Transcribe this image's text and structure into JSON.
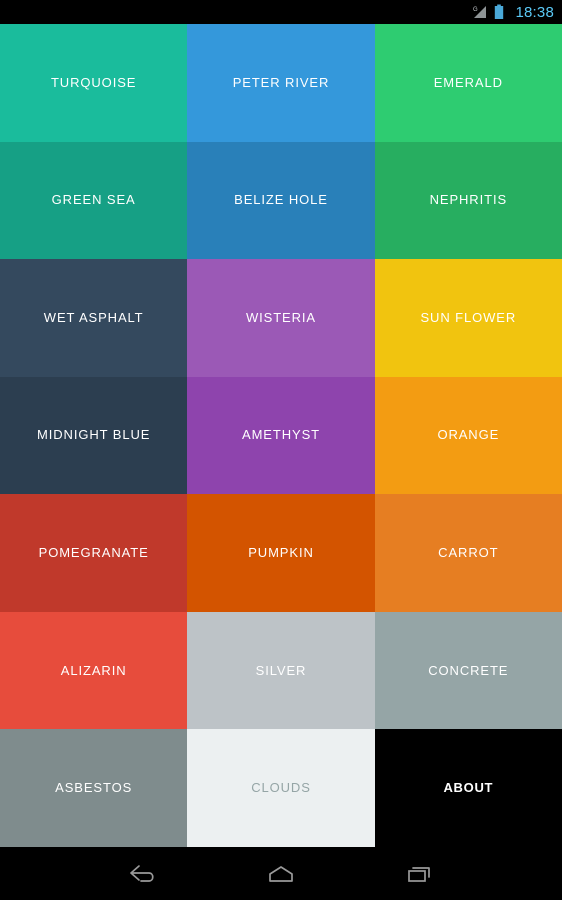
{
  "statusbar": {
    "signal_icon": "signal-g-icon",
    "signal_label": "G",
    "battery_icon": "battery-icon",
    "clock": "18:38",
    "clock_color": "#5bc8f5"
  },
  "grid": {
    "columns": 3,
    "rows": 7,
    "tiles": [
      {
        "label": "TURQUOISE",
        "bg": "#1abc9c",
        "fg": "#ffffff"
      },
      {
        "label": "PETER RIVER",
        "bg": "#3498db",
        "fg": "#ffffff"
      },
      {
        "label": "EMERALD",
        "bg": "#2ecc71",
        "fg": "#ffffff"
      },
      {
        "label": "GREEN SEA",
        "bg": "#16a085",
        "fg": "#ffffff"
      },
      {
        "label": "BELIZE HOLE",
        "bg": "#2980b9",
        "fg": "#ffffff"
      },
      {
        "label": "NEPHRITIS",
        "bg": "#27ae60",
        "fg": "#ffffff"
      },
      {
        "label": "WET ASPHALT",
        "bg": "#34495e",
        "fg": "#ffffff"
      },
      {
        "label": "WISTERIA",
        "bg": "#9b59b6",
        "fg": "#ffffff"
      },
      {
        "label": "SUN FLOWER",
        "bg": "#f1c40f",
        "fg": "#ffffff"
      },
      {
        "label": "MIDNIGHT BLUE",
        "bg": "#2c3e50",
        "fg": "#ffffff"
      },
      {
        "label": "AMETHYST",
        "bg": "#8e44ad",
        "fg": "#ffffff"
      },
      {
        "label": "ORANGE",
        "bg": "#f39c12",
        "fg": "#ffffff"
      },
      {
        "label": "POMEGRANATE",
        "bg": "#c0392b",
        "fg": "#ffffff"
      },
      {
        "label": "PUMPKIN",
        "bg": "#d35400",
        "fg": "#ffffff"
      },
      {
        "label": "CARROT",
        "bg": "#e67e22",
        "fg": "#ffffff"
      },
      {
        "label": "ALIZARIN",
        "bg": "#e74c3c",
        "fg": "#ffffff"
      },
      {
        "label": "SILVER",
        "bg": "#bdc3c7",
        "fg": "#ffffff"
      },
      {
        "label": "CONCRETE",
        "bg": "#95a5a6",
        "fg": "#ffffff"
      },
      {
        "label": "ASBESTOS",
        "bg": "#7f8c8d",
        "fg": "#ffffff"
      },
      {
        "label": "CLOUDS",
        "bg": "#ecf0f1",
        "fg": "#95a5a6"
      },
      {
        "label": "ABOUT",
        "bg": "#000000",
        "fg": "#ffffff"
      }
    ]
  },
  "navbar": {
    "buttons": [
      {
        "name": "back-icon"
      },
      {
        "name": "home-icon"
      },
      {
        "name": "recents-icon"
      }
    ],
    "icon_color": "#9a9a9a"
  }
}
